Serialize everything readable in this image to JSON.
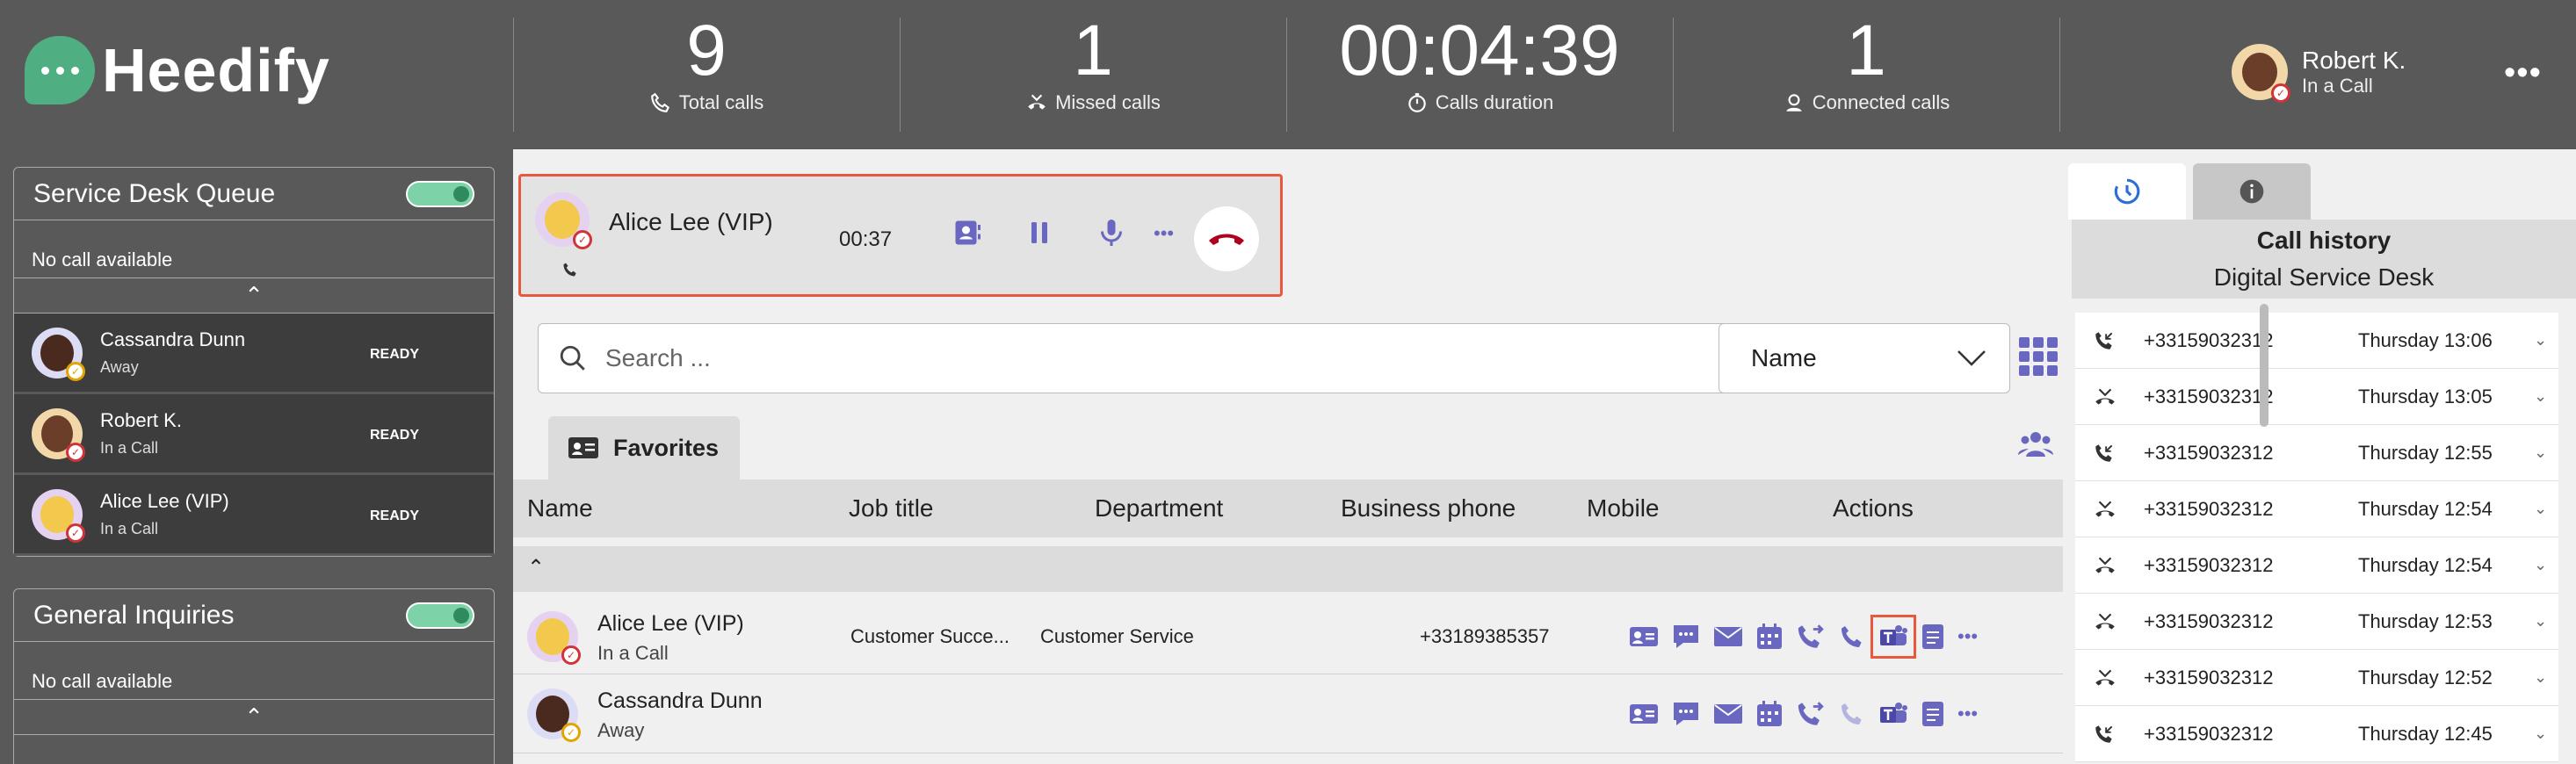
{
  "brand": {
    "name": "Heedify",
    "color": "#4faf82",
    "accent": "#6a67c0"
  },
  "stats": [
    {
      "value": "9",
      "label": "Total calls",
      "icon": "phone-total-icon"
    },
    {
      "value": "1",
      "label": "Missed calls",
      "icon": "missed-call-icon"
    },
    {
      "value": "00:04:39",
      "label": "Calls duration",
      "icon": "timer-icon"
    },
    {
      "value": "1",
      "label": "Connected calls",
      "icon": "agent-icon"
    }
  ],
  "user": {
    "name": "Robert K.",
    "status": "In a Call"
  },
  "queues": [
    {
      "name": "Service Desk Queue",
      "empty": "No call available",
      "agents": [
        {
          "name": "Cassandra Dunn",
          "status": "Away",
          "state": "READY"
        },
        {
          "name": "Robert K.",
          "status": "In a Call",
          "state": "READY"
        },
        {
          "name": "Alice Lee (VIP)",
          "status": "In a Call",
          "state": "READY"
        }
      ]
    },
    {
      "name": "General Inquiries",
      "empty": "No call available"
    }
  ],
  "active_call": {
    "name": "Alice Lee (VIP)",
    "timer": "00:37"
  },
  "search": {
    "placeholder": "Search ..."
  },
  "sort": {
    "selected": "Name"
  },
  "favorites": {
    "label": "Favorites"
  },
  "table": {
    "headers": [
      "Name",
      "Job title",
      "Department",
      "Business phone",
      "Mobile",
      "Actions"
    ],
    "rows": [
      {
        "name": "Alice Lee (VIP)",
        "status": "In a Call",
        "job": "Customer Succe...",
        "dept": "Customer Service",
        "phone": "+33189385357",
        "mobile": ""
      },
      {
        "name": "Cassandra Dunn",
        "status": "Away",
        "job": "",
        "dept": "",
        "phone": "",
        "mobile": ""
      }
    ]
  },
  "history": {
    "title": "Call history",
    "subtitle": "Digital Service Desk",
    "items": [
      {
        "type": "incoming",
        "number": "+33159032312",
        "time": "Thursday 13:06"
      },
      {
        "type": "missed",
        "number": "+33159032312",
        "time": "Thursday 13:05"
      },
      {
        "type": "incoming",
        "number": "+33159032312",
        "time": "Thursday 12:55"
      },
      {
        "type": "missed",
        "number": "+33159032312",
        "time": "Thursday 12:54"
      },
      {
        "type": "missed",
        "number": "+33159032312",
        "time": "Thursday 12:54"
      },
      {
        "type": "missed",
        "number": "+33159032312",
        "time": "Thursday 12:53"
      },
      {
        "type": "missed",
        "number": "+33159032312",
        "time": "Thursday 12:52"
      },
      {
        "type": "incoming",
        "number": "+33159032312",
        "time": "Thursday 12:45"
      }
    ]
  }
}
